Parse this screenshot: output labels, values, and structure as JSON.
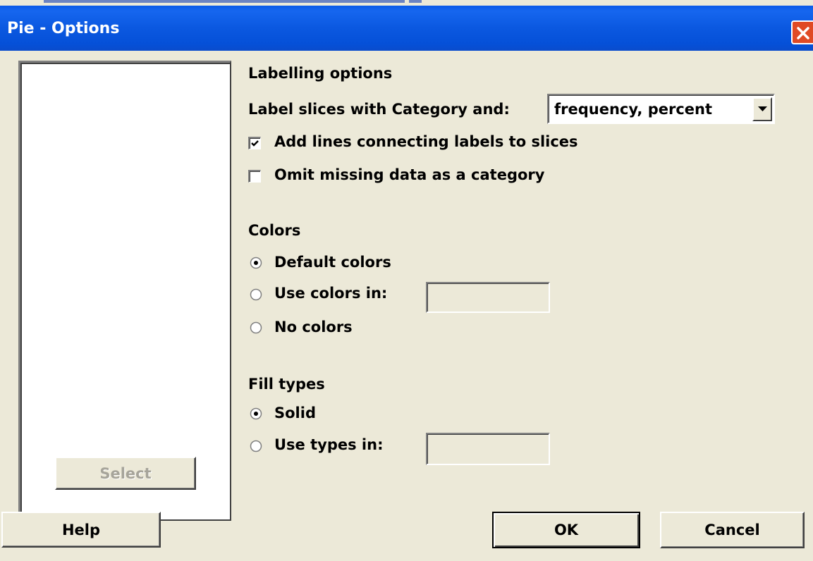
{
  "window": {
    "title": "Pie - Options"
  },
  "left_panel": {
    "select_label": "Select",
    "help_label": "Help"
  },
  "labelling": {
    "heading": "Labelling options",
    "label_slices_text": "Label slices with Category and:",
    "label_slices_value": "frequency, percent",
    "add_lines_label": "Add lines connecting labels to slices",
    "add_lines_checked": true,
    "omit_missing_label": "Omit missing data as a category",
    "omit_missing_checked": false
  },
  "colors": {
    "heading": "Colors",
    "options": [
      "Default colors",
      "Use colors in:",
      "No colors"
    ],
    "selected": "Default colors",
    "use_colors_value": ""
  },
  "fill_types": {
    "heading": "Fill types",
    "options": [
      "Solid",
      "Use types in:"
    ],
    "selected": "Solid",
    "use_types_value": ""
  },
  "buttons": {
    "ok_label": "OK",
    "cancel_label": "Cancel"
  },
  "icons": {
    "close": "close-icon",
    "dropdown": "chevron-down-icon",
    "checkmark": "checkmark-icon"
  },
  "theme": {
    "titlebar": "#0a5ae8",
    "dialog_bg": "#ece9d8",
    "close_red": "#e04a25"
  }
}
